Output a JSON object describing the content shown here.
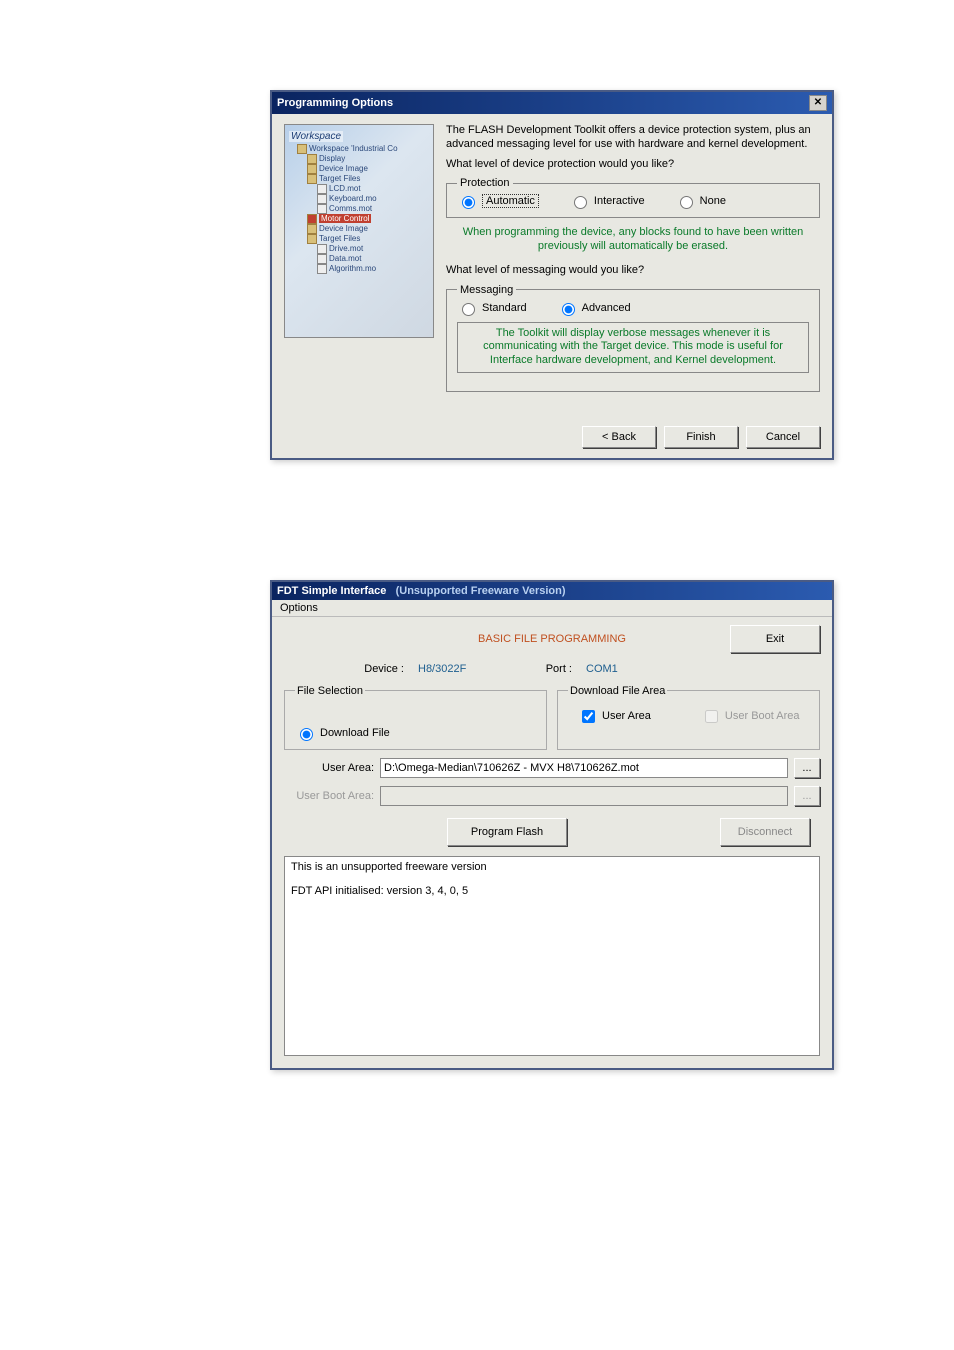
{
  "wizard": {
    "title": "Programming Options",
    "tree": {
      "root": "Workspace",
      "l1": "Workspace 'Industrial Co",
      "l2": "Display",
      "l3": "Device Image",
      "l4": "Target Files",
      "f1": "LCD.mot",
      "f2": "Keyboard.mo",
      "f3": "Comms.mot",
      "l5": "Motor Control",
      "l6": "Device Image",
      "l7": "Target Files",
      "f4": "Drive.mot",
      "f5": "Data.mot",
      "f6": "Algorithm.mo"
    },
    "intro": "The FLASH Development Toolkit offers a device protection system, plus an advanced messaging level for use with hardware and kernel development.",
    "q1": "What level of device protection would you like?",
    "protection": {
      "legend": "Protection",
      "automatic": "Automatic",
      "interactive": "Interactive",
      "none": "None"
    },
    "green": "When programming the device, any blocks found to have been written previously will automatically be erased.",
    "q2": "What level of messaging would you like?",
    "messaging": {
      "legend": "Messaging",
      "standard": "Standard",
      "advanced": "Advanced"
    },
    "help": "The Toolkit will display verbose messages whenever it is communicating with the Target device. This mode is useful for Interface hardware development, and Kernel development.",
    "back": "< Back",
    "finish": "Finish",
    "cancel": "Cancel"
  },
  "simple": {
    "title_left": "FDT Simple Interface",
    "title_right": "(Unsupported Freeware Version)",
    "menu_options": "Options",
    "section": "BASIC FILE PROGRAMMING",
    "exit": "Exit",
    "device_label": "Device :",
    "device_value": "H8/3022F",
    "port_label": "Port :",
    "port_value": "COM1",
    "file_selection_legend": "File Selection",
    "download_area_legend": "Download File Area",
    "download_file": "Download File",
    "user_area_check": "User Area",
    "user_boot_check": "User Boot Area",
    "user_area_label": "User Area:",
    "user_area_value": "D:\\Omega-Median\\710626Z - MVX H8\\710626Z.mot",
    "user_boot_label": "User Boot Area:",
    "browse": "...",
    "program_flash": "Program Flash",
    "disconnect": "Disconnect",
    "log1": "This is an unsupported freeware version",
    "log2": "FDT API initialised: version 3, 4, 0, 5"
  }
}
